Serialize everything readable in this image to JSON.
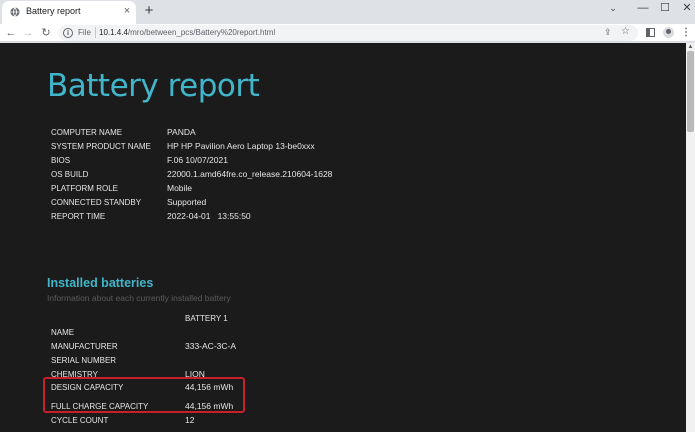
{
  "browser": {
    "tab_title": "Battery report",
    "tab_close": "×",
    "new_tab": "+",
    "scheme_label": "File",
    "url_host": "10.1.4.4",
    "url_path": "/mro/between_pcs/Battery%20report.html",
    "window_controls": {
      "minimize": "—",
      "maximize": "☐",
      "close": "✕",
      "search": "⌄"
    },
    "icons": [
      "back-arrow-icon",
      "forward-arrow-icon",
      "reload-icon",
      "info-icon",
      "share-icon",
      "star-icon",
      "side-panel-icon",
      "profile-icon",
      "menu-icon"
    ]
  },
  "report": {
    "title": "Battery report",
    "system": [
      {
        "label": "COMPUTER NAME",
        "value": "PANDA"
      },
      {
        "label": "SYSTEM PRODUCT NAME",
        "value": "HP HP Pavilion Aero Laptop 13-be0xxx"
      },
      {
        "label": "BIOS",
        "value": "F.06 10/07/2021"
      },
      {
        "label": "OS BUILD",
        "value": "22000.1.amd64fre.co_release.210604-1628"
      },
      {
        "label": "PLATFORM ROLE",
        "value": "Mobile"
      },
      {
        "label": "CONNECTED STANDBY",
        "value": "Supported"
      },
      {
        "label": "REPORT TIME",
        "value": "2022-04-01   13:55:50"
      }
    ],
    "installed": {
      "title": "Installed batteries",
      "subtitle": "Information about each currently installed battery",
      "column_header": "BATTERY 1",
      "rows": [
        {
          "label": "NAME",
          "value": ""
        },
        {
          "label": "MANUFACTURER",
          "value": "333-AC-3C-A"
        },
        {
          "label": "SERIAL NUMBER",
          "value": ""
        },
        {
          "label": "CHEMISTRY",
          "value": "LION"
        },
        {
          "label": "DESIGN CAPACITY",
          "value": "44,156 mWh"
        },
        {
          "label": "FULL CHARGE CAPACITY",
          "value": "44,156 mWh"
        },
        {
          "label": "CYCLE COUNT",
          "value": "12"
        }
      ]
    }
  },
  "colors": {
    "accent": "#41b5c9",
    "page_bg": "#1b1b1b",
    "highlight": "#c8202a"
  }
}
